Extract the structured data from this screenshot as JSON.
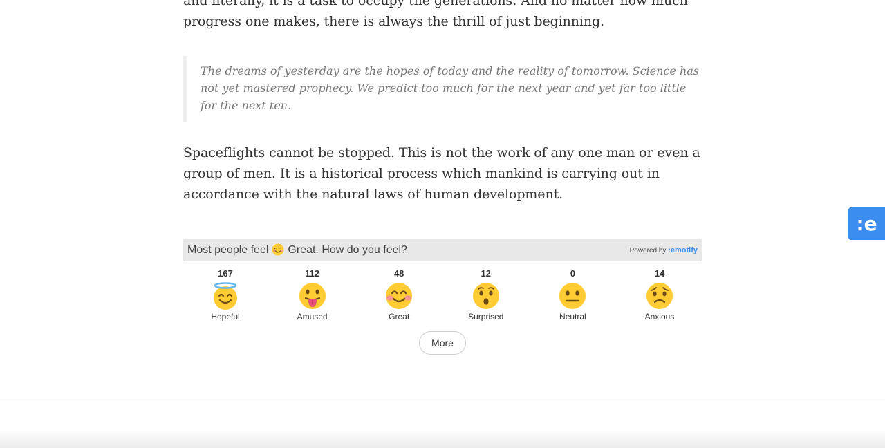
{
  "article": {
    "para1_line1": "and literally, it is a task to occupy the generations. And no matter how much",
    "para1_line2": "progress one makes, there is always the thrill of just beginning.",
    "quote": "The dreams of yesterday are the hopes of today and the reality of tomorrow. Science has not yet mastered prophecy. We predict too much for the next year and yet far too little for the next ten.",
    "para2": "Spaceflights cannot be stopped. This is not the work of any one man or even a group of men. It is a historical process which mankind is carrying out in accordance with the natural laws of human development."
  },
  "emotify": {
    "head_prefix": "Most people feel",
    "head_emoji_icon": "smiling-blush-icon",
    "head_suffix": "Great. How do you feel?",
    "powered_by": "Powered by",
    "brand": ":emotify",
    "reactions": [
      {
        "count": "167",
        "label": "Hopeful",
        "icon": "halo-face-icon"
      },
      {
        "count": "112",
        "label": "Amused",
        "icon": "tongue-face-icon"
      },
      {
        "count": "48",
        "label": "Great",
        "icon": "blush-face-icon"
      },
      {
        "count": "12",
        "label": "Surprised",
        "icon": "surprised-face-icon"
      },
      {
        "count": "0",
        "label": "Neutral",
        "icon": "neutral-face-icon"
      },
      {
        "count": "14",
        "label": "Anxious",
        "icon": "anxious-face-icon"
      }
    ],
    "more_label": "More",
    "side_tab_label": ":e"
  },
  "colors": {
    "accent": "#3b8ef0",
    "emoji_yellow": "#ffcc33",
    "header_bg": "#e8e8e8"
  }
}
